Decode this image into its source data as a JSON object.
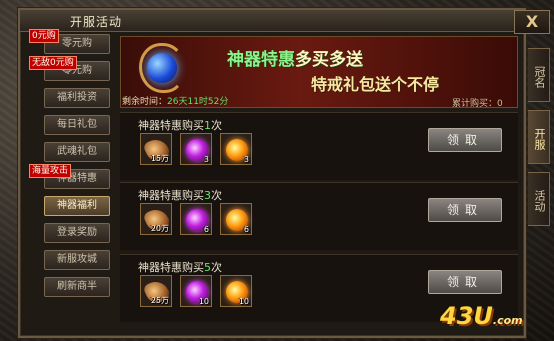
{
  "window": {
    "title": "开服活动",
    "close_label": "X"
  },
  "side_tabs": [
    "冠名",
    "开服",
    "活动"
  ],
  "menu": [
    {
      "label": "零元购",
      "badge": "0元购"
    },
    {
      "label": "零元购",
      "badge": "无敌0元购"
    },
    {
      "label": "福利投资",
      "badge": ""
    },
    {
      "label": "每日礼包",
      "badge": ""
    },
    {
      "label": "武魂礼包",
      "badge": ""
    },
    {
      "label": "神器特惠",
      "badge": "海量攻击"
    },
    {
      "label": "神器福利",
      "badge": ""
    },
    {
      "label": "登录奖励",
      "badge": ""
    },
    {
      "label": "新服攻城",
      "badge": ""
    },
    {
      "label": "刷新商半",
      "badge": ""
    }
  ],
  "banner": {
    "title_left": "神器特惠",
    "title_right": "多买多送",
    "subtitle": "特戒礼包送个不停",
    "countdown_label": "剩余时间：",
    "countdown_value": "26天11时52分",
    "total_label": "累计购买：",
    "total_value": "0"
  },
  "offers": [
    {
      "title_prefix": "神器特惠购买",
      "count": "1",
      "title_suffix": "次",
      "items": [
        {
          "icon": "feather",
          "qty": "15万"
        },
        {
          "icon": "purple-orb",
          "qty": "3"
        },
        {
          "icon": "orange-orb",
          "qty": "3"
        }
      ],
      "button": "领取"
    },
    {
      "title_prefix": "神器特惠购买",
      "count": "3",
      "title_suffix": "次",
      "items": [
        {
          "icon": "feather",
          "qty": "20万"
        },
        {
          "icon": "purple-orb",
          "qty": "6"
        },
        {
          "icon": "orange-orb",
          "qty": "6"
        }
      ],
      "button": "领取"
    },
    {
      "title_prefix": "神器特惠购买",
      "count": "5",
      "title_suffix": "次",
      "items": [
        {
          "icon": "feather",
          "qty": "25万"
        },
        {
          "icon": "purple-orb",
          "qty": "10"
        },
        {
          "icon": "orange-orb",
          "qty": "10"
        }
      ],
      "button": "领取"
    }
  ],
  "watermark": {
    "main": "43U",
    "suffix": ".com"
  }
}
